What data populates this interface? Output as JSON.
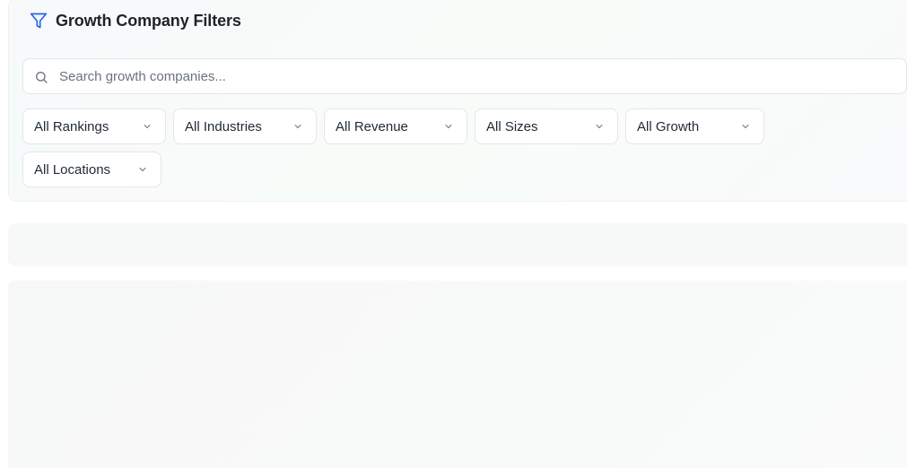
{
  "header": {
    "title": "Growth Company Filters",
    "icon": "filter-icon",
    "icon_color": "#2563eb"
  },
  "search": {
    "placeholder": "Search growth companies...",
    "value": "",
    "icon": "search-icon"
  },
  "filters": [
    {
      "label": "All Rankings"
    },
    {
      "label": "All Industries"
    },
    {
      "label": "All Revenue"
    },
    {
      "label": "All Sizes"
    },
    {
      "label": "All Growth"
    },
    {
      "label": "All Locations"
    }
  ]
}
